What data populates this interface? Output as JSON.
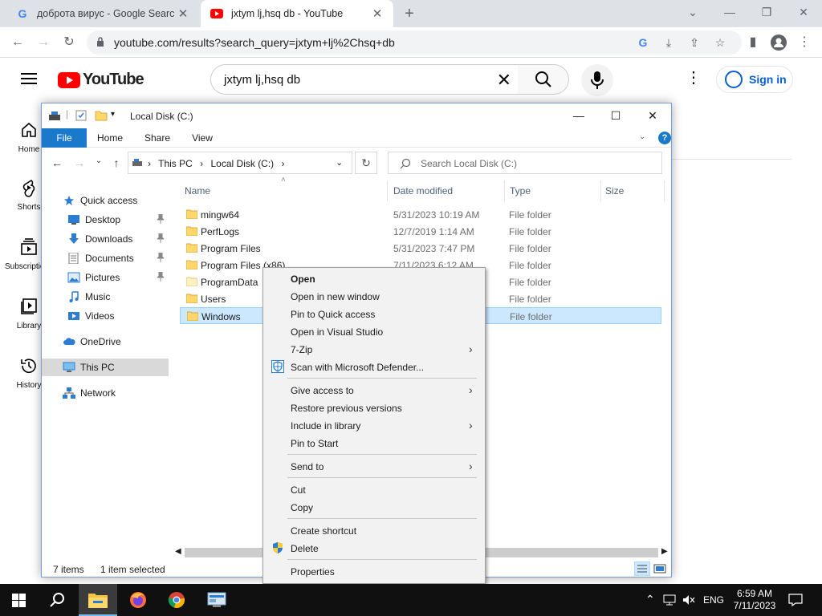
{
  "browser": {
    "tabs": [
      {
        "title": "доброта вирус - Google Search",
        "icon": "google-icon"
      },
      {
        "title": "jxtym lj,hsq db - YouTube",
        "icon": "youtube-icon"
      }
    ],
    "url": "youtube.com/results?search_query=jxtym+lj%2Chsq+db"
  },
  "youtube": {
    "logo_text": "YouTube",
    "search_query": "jxtym lj,hsq db",
    "signin_label": "Sign in",
    "sidebar": [
      {
        "label": "Home",
        "icon": "home-icon"
      },
      {
        "label": "Shorts",
        "icon": "shorts-icon"
      },
      {
        "label": "Subscriptions",
        "icon": "subscriptions-icon"
      },
      {
        "label": "Library",
        "icon": "library-icon"
      },
      {
        "label": "History",
        "icon": "history-icon"
      }
    ]
  },
  "explorer": {
    "title": "Local Disk (C:)",
    "ribbon_tabs": [
      "File",
      "Home",
      "Share",
      "View"
    ],
    "breadcrumb": [
      "This PC",
      "Local Disk (C:)"
    ],
    "search_placeholder": "Search Local Disk (C:)",
    "nav": [
      {
        "label": "Quick access",
        "icon": "star-icon"
      },
      {
        "label": "Desktop",
        "icon": "desktop-icon",
        "pinned": true
      },
      {
        "label": "Downloads",
        "icon": "downloads-icon",
        "pinned": true
      },
      {
        "label": "Documents",
        "icon": "documents-icon",
        "pinned": true
      },
      {
        "label": "Pictures",
        "icon": "pictures-icon",
        "pinned": true
      },
      {
        "label": "Music",
        "icon": "music-icon"
      },
      {
        "label": "Videos",
        "icon": "videos-icon"
      },
      {
        "label": "OneDrive",
        "icon": "cloud-icon"
      },
      {
        "label": "This PC",
        "icon": "computer-icon",
        "selected": true
      },
      {
        "label": "Network",
        "icon": "network-icon"
      }
    ],
    "columns": [
      "Name",
      "Date modified",
      "Type",
      "Size"
    ],
    "files": [
      {
        "name": "mingw64",
        "date": "5/31/2023 10:19 AM",
        "type": "File folder"
      },
      {
        "name": "PerfLogs",
        "date": "12/7/2019 1:14 AM",
        "type": "File folder"
      },
      {
        "name": "Program Files",
        "date": "5/31/2023 7:47 PM",
        "type": "File folder"
      },
      {
        "name": "Program Files (x86)",
        "date": "7/11/2023 6:12 AM",
        "type": "File folder"
      },
      {
        "name": "ProgramData",
        "date": "",
        "type": "File folder"
      },
      {
        "name": "Users",
        "date": "",
        "type": "File folder"
      },
      {
        "name": "Windows",
        "date": "",
        "type": "File folder",
        "selected": true
      }
    ],
    "status_items": "7 items",
    "status_selected": "1 item selected"
  },
  "context_menu": {
    "items": [
      {
        "label": "Open",
        "bold": true
      },
      {
        "label": "Open in new window"
      },
      {
        "label": "Pin to Quick access"
      },
      {
        "label": "Open in Visual Studio"
      },
      {
        "label": "7-Zip",
        "submenu": true
      },
      {
        "label": "Scan with Microsoft Defender...",
        "icon": "defender-icon"
      },
      {
        "label": "Give access to",
        "submenu": true
      },
      {
        "label": "Restore previous versions"
      },
      {
        "label": "Include in library",
        "submenu": true
      },
      {
        "label": "Pin to Start"
      },
      {
        "label": "Send to",
        "submenu": true
      },
      {
        "label": "Cut"
      },
      {
        "label": "Copy"
      },
      {
        "label": "Create shortcut"
      },
      {
        "label": "Delete",
        "icon": "shield-icon"
      },
      {
        "label": "Properties"
      }
    ]
  },
  "taskbar": {
    "language": "ENG",
    "time": "6:59 AM",
    "date": "7/11/2023"
  }
}
